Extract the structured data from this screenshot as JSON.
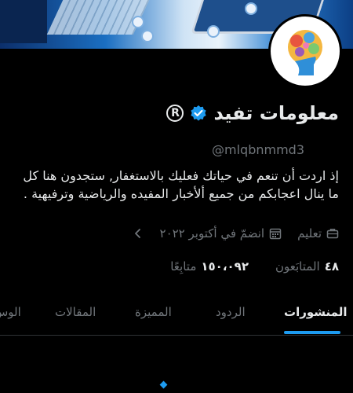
{
  "profile": {
    "display_name": "معلومات تفيد",
    "handle": "@mlqbnmmd3",
    "registered_symbol": "R",
    "bio_lines": [
      "إذ اردت أن تنعم في حياتك فعليك بالاستغفار, ستجدون هنا كل",
      "ما ينال اعجابكم من جميع ألأخبار المفيده والرياضية وترفيهية ."
    ],
    "category": "تعليم",
    "joined": "انضمّ في أكتوبر ٢٠٢٢",
    "following_count": "٤٨",
    "following_label": "المتابَعون",
    "followers_count": "١٥٠،٠٩٢",
    "followers_label": "متابِعًا"
  },
  "tabs": [
    {
      "label": "المنشورات",
      "active": true
    },
    {
      "label": "الردود",
      "active": false
    },
    {
      "label": "المميزة",
      "active": false
    },
    {
      "label": "المقالات",
      "active": false
    },
    {
      "label": "الوس",
      "active": false
    }
  ],
  "colors": {
    "accent": "#1d9bf0",
    "background": "#000000",
    "secondary_text": "#71767b"
  },
  "icons": [
    "verified-badge-icon",
    "registered-icon",
    "briefcase-icon",
    "calendar-icon",
    "chevron-left-icon"
  ]
}
